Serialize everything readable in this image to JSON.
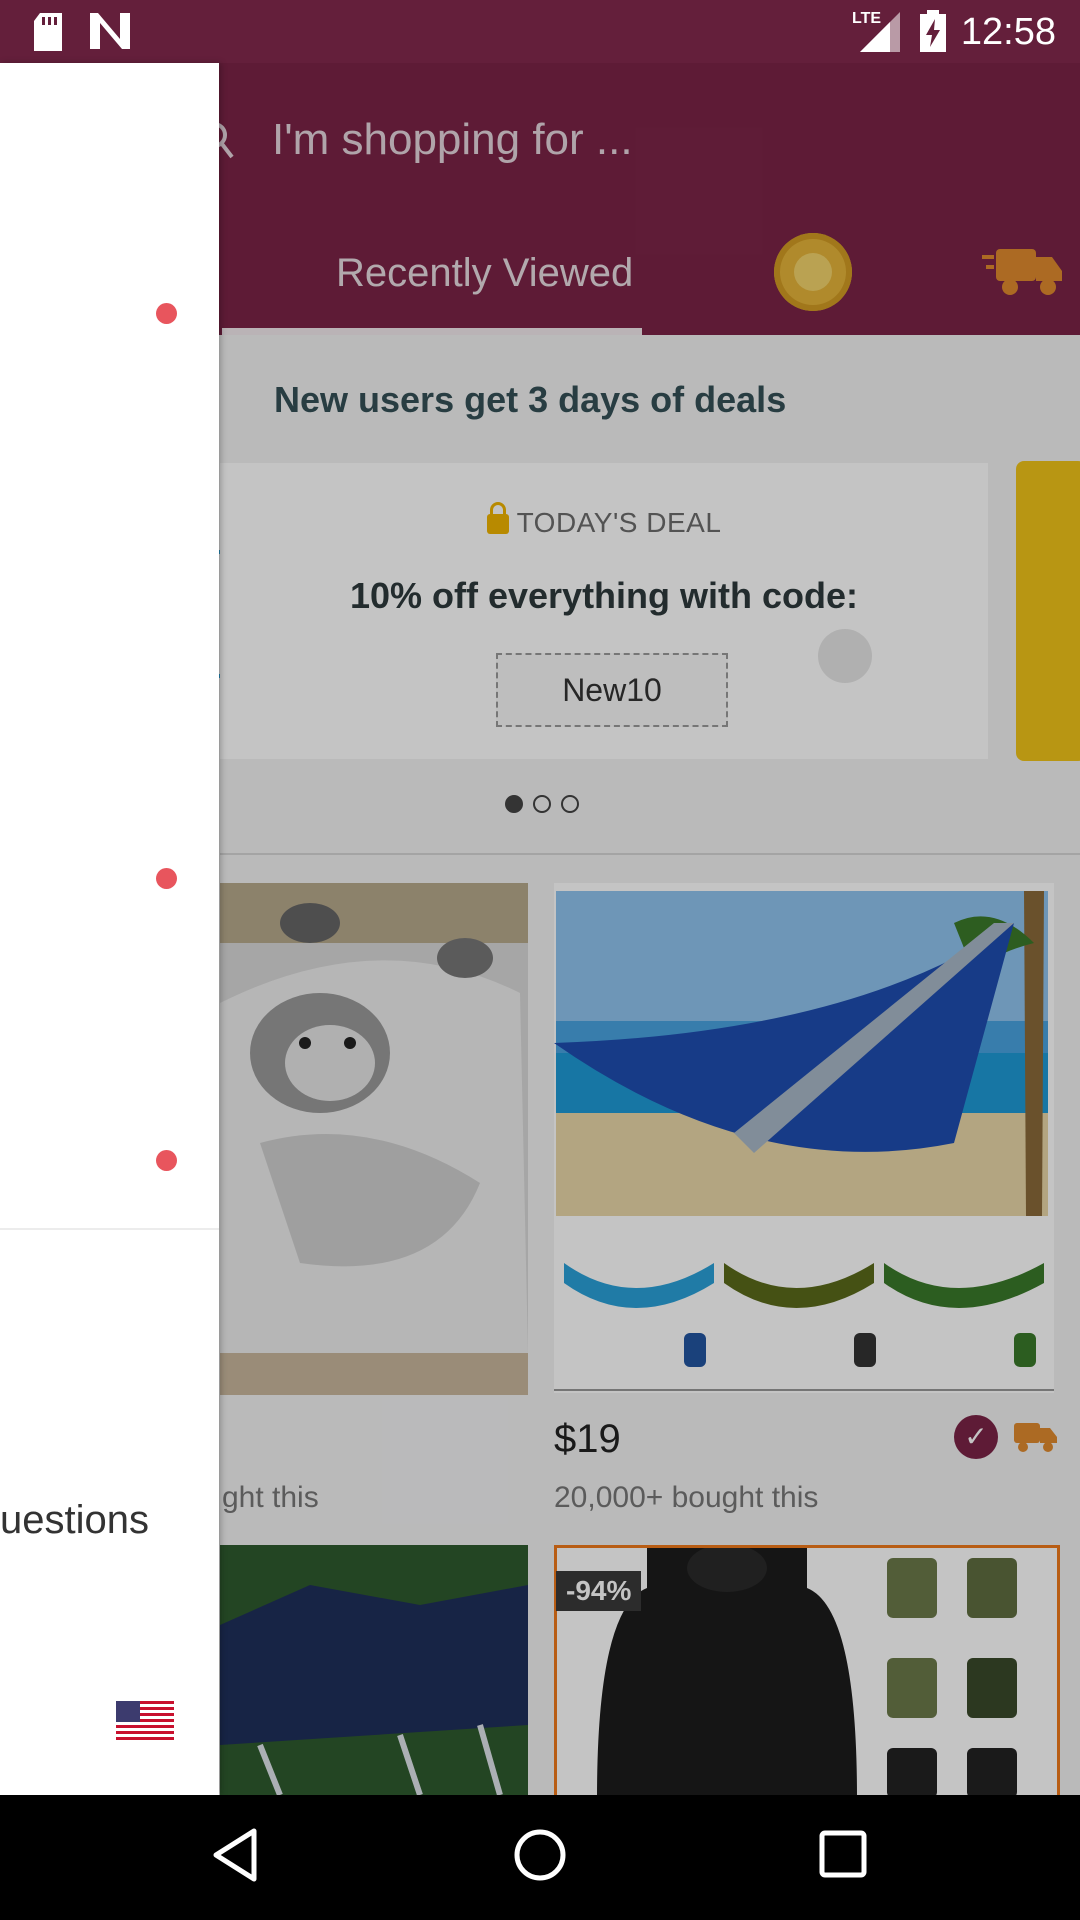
{
  "status_bar": {
    "time": "12:58",
    "network": "LTE"
  },
  "header": {
    "search_placeholder": "I'm shopping for ...",
    "tab_recently_viewed": "Recently Viewed"
  },
  "banner": {
    "title": "New users get 3 days of deals",
    "deal_label": "TODAY'S DEAL",
    "deal_text": "10% off everything with code:",
    "code": "New10",
    "page_count": 3,
    "active_page": 1
  },
  "products": [
    {
      "bought": "ght this"
    },
    {
      "price": "$19",
      "bought": "20,000+ bought this"
    },
    {},
    {
      "discount": "-94%"
    }
  ],
  "drawer": {
    "partial_item": "uestions"
  },
  "colors": {
    "brand": "#7b2447",
    "status_bar": "#641f3b",
    "accent_dot": "#e8555d",
    "deal_highlight": "#f0b400"
  }
}
